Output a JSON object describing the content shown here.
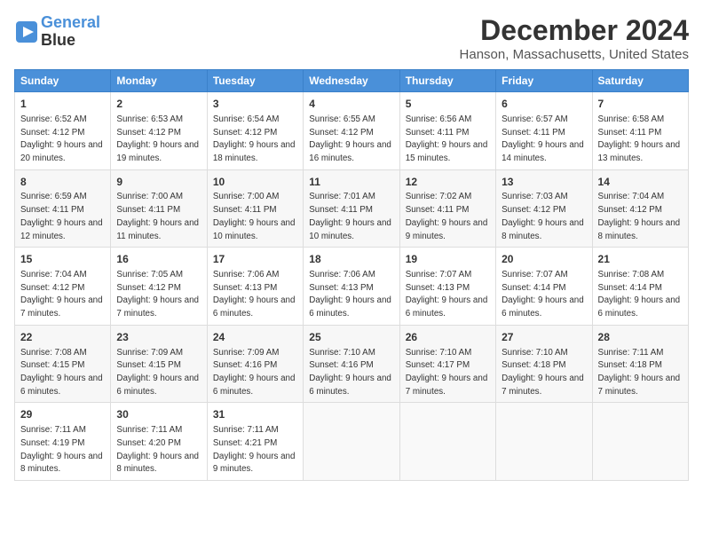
{
  "header": {
    "logo_line1": "General",
    "logo_line2": "Blue",
    "title": "December 2024",
    "subtitle": "Hanson, Massachusetts, United States"
  },
  "weekdays": [
    "Sunday",
    "Monday",
    "Tuesday",
    "Wednesday",
    "Thursday",
    "Friday",
    "Saturday"
  ],
  "weeks": [
    [
      {
        "day": "1",
        "sunrise": "6:52 AM",
        "sunset": "4:12 PM",
        "daylight": "9 hours and 20 minutes."
      },
      {
        "day": "2",
        "sunrise": "6:53 AM",
        "sunset": "4:12 PM",
        "daylight": "9 hours and 19 minutes."
      },
      {
        "day": "3",
        "sunrise": "6:54 AM",
        "sunset": "4:12 PM",
        "daylight": "9 hours and 18 minutes."
      },
      {
        "day": "4",
        "sunrise": "6:55 AM",
        "sunset": "4:12 PM",
        "daylight": "9 hours and 16 minutes."
      },
      {
        "day": "5",
        "sunrise": "6:56 AM",
        "sunset": "4:11 PM",
        "daylight": "9 hours and 15 minutes."
      },
      {
        "day": "6",
        "sunrise": "6:57 AM",
        "sunset": "4:11 PM",
        "daylight": "9 hours and 14 minutes."
      },
      {
        "day": "7",
        "sunrise": "6:58 AM",
        "sunset": "4:11 PM",
        "daylight": "9 hours and 13 minutes."
      }
    ],
    [
      {
        "day": "8",
        "sunrise": "6:59 AM",
        "sunset": "4:11 PM",
        "daylight": "9 hours and 12 minutes."
      },
      {
        "day": "9",
        "sunrise": "7:00 AM",
        "sunset": "4:11 PM",
        "daylight": "9 hours and 11 minutes."
      },
      {
        "day": "10",
        "sunrise": "7:00 AM",
        "sunset": "4:11 PM",
        "daylight": "9 hours and 10 minutes."
      },
      {
        "day": "11",
        "sunrise": "7:01 AM",
        "sunset": "4:11 PM",
        "daylight": "9 hours and 10 minutes."
      },
      {
        "day": "12",
        "sunrise": "7:02 AM",
        "sunset": "4:11 PM",
        "daylight": "9 hours and 9 minutes."
      },
      {
        "day": "13",
        "sunrise": "7:03 AM",
        "sunset": "4:12 PM",
        "daylight": "9 hours and 8 minutes."
      },
      {
        "day": "14",
        "sunrise": "7:04 AM",
        "sunset": "4:12 PM",
        "daylight": "9 hours and 8 minutes."
      }
    ],
    [
      {
        "day": "15",
        "sunrise": "7:04 AM",
        "sunset": "4:12 PM",
        "daylight": "9 hours and 7 minutes."
      },
      {
        "day": "16",
        "sunrise": "7:05 AM",
        "sunset": "4:12 PM",
        "daylight": "9 hours and 7 minutes."
      },
      {
        "day": "17",
        "sunrise": "7:06 AM",
        "sunset": "4:13 PM",
        "daylight": "9 hours and 6 minutes."
      },
      {
        "day": "18",
        "sunrise": "7:06 AM",
        "sunset": "4:13 PM",
        "daylight": "9 hours and 6 minutes."
      },
      {
        "day": "19",
        "sunrise": "7:07 AM",
        "sunset": "4:13 PM",
        "daylight": "9 hours and 6 minutes."
      },
      {
        "day": "20",
        "sunrise": "7:07 AM",
        "sunset": "4:14 PM",
        "daylight": "9 hours and 6 minutes."
      },
      {
        "day": "21",
        "sunrise": "7:08 AM",
        "sunset": "4:14 PM",
        "daylight": "9 hours and 6 minutes."
      }
    ],
    [
      {
        "day": "22",
        "sunrise": "7:08 AM",
        "sunset": "4:15 PM",
        "daylight": "9 hours and 6 minutes."
      },
      {
        "day": "23",
        "sunrise": "7:09 AM",
        "sunset": "4:15 PM",
        "daylight": "9 hours and 6 minutes."
      },
      {
        "day": "24",
        "sunrise": "7:09 AM",
        "sunset": "4:16 PM",
        "daylight": "9 hours and 6 minutes."
      },
      {
        "day": "25",
        "sunrise": "7:10 AM",
        "sunset": "4:16 PM",
        "daylight": "9 hours and 6 minutes."
      },
      {
        "day": "26",
        "sunrise": "7:10 AM",
        "sunset": "4:17 PM",
        "daylight": "9 hours and 7 minutes."
      },
      {
        "day": "27",
        "sunrise": "7:10 AM",
        "sunset": "4:18 PM",
        "daylight": "9 hours and 7 minutes."
      },
      {
        "day": "28",
        "sunrise": "7:11 AM",
        "sunset": "4:18 PM",
        "daylight": "9 hours and 7 minutes."
      }
    ],
    [
      {
        "day": "29",
        "sunrise": "7:11 AM",
        "sunset": "4:19 PM",
        "daylight": "9 hours and 8 minutes."
      },
      {
        "day": "30",
        "sunrise": "7:11 AM",
        "sunset": "4:20 PM",
        "daylight": "9 hours and 8 minutes."
      },
      {
        "day": "31",
        "sunrise": "7:11 AM",
        "sunset": "4:21 PM",
        "daylight": "9 hours and 9 minutes."
      },
      null,
      null,
      null,
      null
    ]
  ]
}
